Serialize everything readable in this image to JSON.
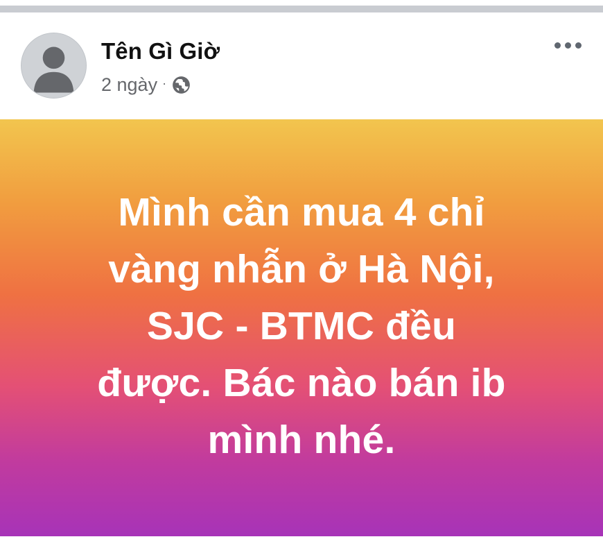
{
  "post": {
    "author_name": "Tên Gì Giờ",
    "timestamp": "2 ngày",
    "separator": "·",
    "privacy_icon": "globe-icon",
    "menu_icon": "more-horizontal-icon",
    "status_text": "Mình cần mua 4 chỉ\nvàng nhẫn ở Hà Nội,\nSJC - BTMC đều\nđược. Bác nào bán ib\nmình nhé.",
    "background_colors": [
      "#f2c54e",
      "#f19d3f",
      "#ef7142",
      "#e45075",
      "#c13b9e",
      "#a733b8"
    ]
  }
}
